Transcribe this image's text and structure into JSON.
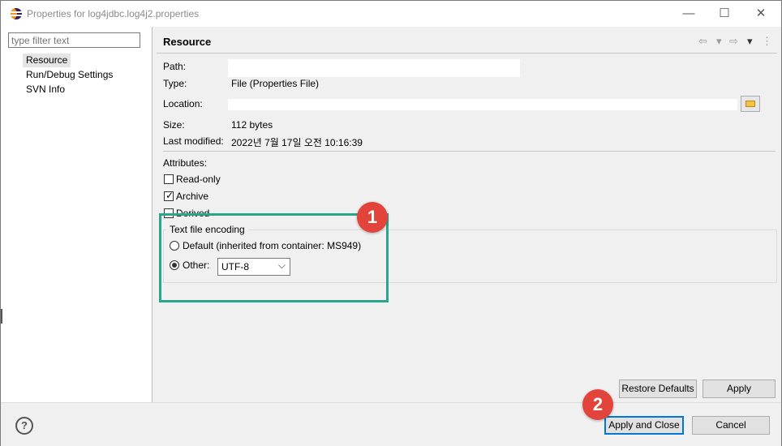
{
  "window": {
    "title": "Properties for log4jdbc.log4j2.properties",
    "minimize": "—",
    "maximize": "☐",
    "close": "✕"
  },
  "filter": {
    "placeholder": "type filter text"
  },
  "tree": {
    "items": [
      {
        "label": "Resource",
        "selected": true
      },
      {
        "label": "Run/Debug Settings",
        "selected": false
      },
      {
        "label": "SVN Info",
        "selected": false
      }
    ]
  },
  "section": {
    "title": "Resource",
    "back_icon": "⇦",
    "forward_icon": "⇨",
    "dropdown_icon": "▾",
    "menu_icon": "⋮"
  },
  "properties": {
    "path_label": "Path:",
    "type_label": "Type:",
    "type_value": "File  (Properties File)",
    "location_label": "Location:",
    "size_label": "Size:",
    "size_value": "112  bytes",
    "modified_label": "Last modified:",
    "modified_value": "2022년 7월 17일 오전 10:16:39"
  },
  "attributes": {
    "label": "Attributes:",
    "items": [
      {
        "label": "Read-only",
        "checked": false
      },
      {
        "label": "Archive",
        "checked": true
      },
      {
        "label": "Derived",
        "checked": false
      }
    ]
  },
  "encoding": {
    "legend": "Text file encoding",
    "default_label": "Default (inherited from container: MS949)",
    "other_label": "Other:",
    "selected": "other",
    "other_value": "UTF-8"
  },
  "buttons": {
    "restore_defaults": "Restore Defaults",
    "apply": "Apply",
    "apply_and_close": "Apply and Close",
    "cancel": "Cancel",
    "help": "?"
  },
  "annotations": {
    "badge_1": "1",
    "badge_2": "2",
    "badge_color": "#e2443c",
    "highlight_color": "#2ba58d"
  },
  "colors": {
    "panel_background": "#f0f0f0",
    "selection": "#e5e5e5",
    "default_button_border": "#0078d7"
  }
}
